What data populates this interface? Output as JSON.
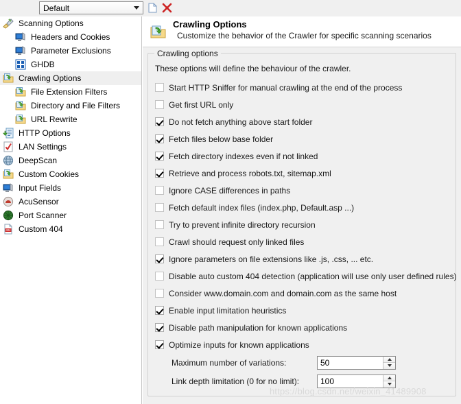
{
  "toolbar": {
    "profile_value": "Default",
    "profile_options": [
      "Default"
    ],
    "new_icon": "new-document-icon",
    "delete_icon": "delete-red-x-icon",
    "dropdown_icon": "chevron-down-icon"
  },
  "sidebar": {
    "items": [
      {
        "label": "Scanning Options",
        "level": 0,
        "icon": "scanning-options-icon",
        "selected": false
      },
      {
        "label": "Headers and Cookies",
        "level": 1,
        "icon": "monitor-icon",
        "selected": false
      },
      {
        "label": "Parameter Exclusions",
        "level": 1,
        "icon": "monitor-icon",
        "selected": false
      },
      {
        "label": "GHDB",
        "level": 1,
        "icon": "ghdb-grid-icon",
        "selected": false
      },
      {
        "label": "Crawling Options",
        "level": 0,
        "icon": "crawling-folder-icon",
        "selected": true
      },
      {
        "label": "File Extension Filters",
        "level": 1,
        "icon": "crawling-folder-icon",
        "selected": false
      },
      {
        "label": "Directory and File Filters",
        "level": 1,
        "icon": "crawling-folder-icon",
        "selected": false
      },
      {
        "label": "URL Rewrite",
        "level": 1,
        "icon": "crawling-folder-icon",
        "selected": false
      },
      {
        "label": "HTTP Options",
        "level": 0,
        "icon": "http-options-icon",
        "selected": false
      },
      {
        "label": "LAN Settings",
        "level": 0,
        "icon": "lan-settings-icon",
        "selected": false
      },
      {
        "label": "DeepScan",
        "level": 0,
        "icon": "globe-icon",
        "selected": false
      },
      {
        "label": "Custom Cookies",
        "level": 0,
        "icon": "crawling-folder-icon",
        "selected": false
      },
      {
        "label": "Input Fields",
        "level": 0,
        "icon": "monitor-icon",
        "selected": false
      },
      {
        "label": "AcuSensor",
        "level": 0,
        "icon": "acusensor-icon",
        "selected": false
      },
      {
        "label": "Port Scanner",
        "level": 0,
        "icon": "port-scanner-icon",
        "selected": false
      },
      {
        "label": "Custom 404",
        "level": 0,
        "icon": "custom-404-icon",
        "selected": false
      }
    ]
  },
  "header": {
    "title": "Crawling Options",
    "subtitle": "Customize the behavior of the Crawler for specific scanning scenarios",
    "icon": "crawling-folder-icon"
  },
  "group": {
    "legend": "Crawling options",
    "description": "These options will define the behaviour of the crawler.",
    "checkboxes": [
      {
        "label": "Start HTTP Sniffer for manual crawling at the end of the process",
        "checked": false
      },
      {
        "label": "Get first URL only",
        "checked": false
      },
      {
        "label": "Do not fetch anything above start folder",
        "checked": true
      },
      {
        "label": "Fetch files below base folder",
        "checked": true
      },
      {
        "label": "Fetch directory indexes even if not linked",
        "checked": true
      },
      {
        "label": "Retrieve and process robots.txt, sitemap.xml",
        "checked": true
      },
      {
        "label": "Ignore CASE differences in paths",
        "checked": false
      },
      {
        "label": "Fetch default index files (index.php, Default.asp ...)",
        "checked": false
      },
      {
        "label": "Try to prevent infinite directory recursion",
        "checked": false
      },
      {
        "label": "Crawl should request only linked files",
        "checked": false
      },
      {
        "label": "Ignore parameters on file extensions like .js, .css, ... etc.",
        "checked": true
      },
      {
        "label": "Disable auto custom 404 detection (application will use only user defined rules)",
        "checked": false
      },
      {
        "label": "Consider www.domain.com and domain.com as the same host",
        "checked": false
      },
      {
        "label": "Enable input limitation heuristics",
        "checked": true
      },
      {
        "label": "Disable path manipulation for known applications",
        "checked": true
      },
      {
        "label": "Optimize inputs for known applications",
        "checked": true
      }
    ],
    "fields": [
      {
        "label": "Maximum number of variations:",
        "value": "50"
      },
      {
        "label": "Link depth limitation (0 for no limit):",
        "value": "100"
      }
    ]
  },
  "watermark": {
    "text": "https://blog.csdn.net/weixin_41489908"
  },
  "colors": {
    "panel_bg": "#f0f0f0",
    "selection": "#efefef",
    "delete_red": "#cc2222",
    "border": "#d0d0d0"
  }
}
